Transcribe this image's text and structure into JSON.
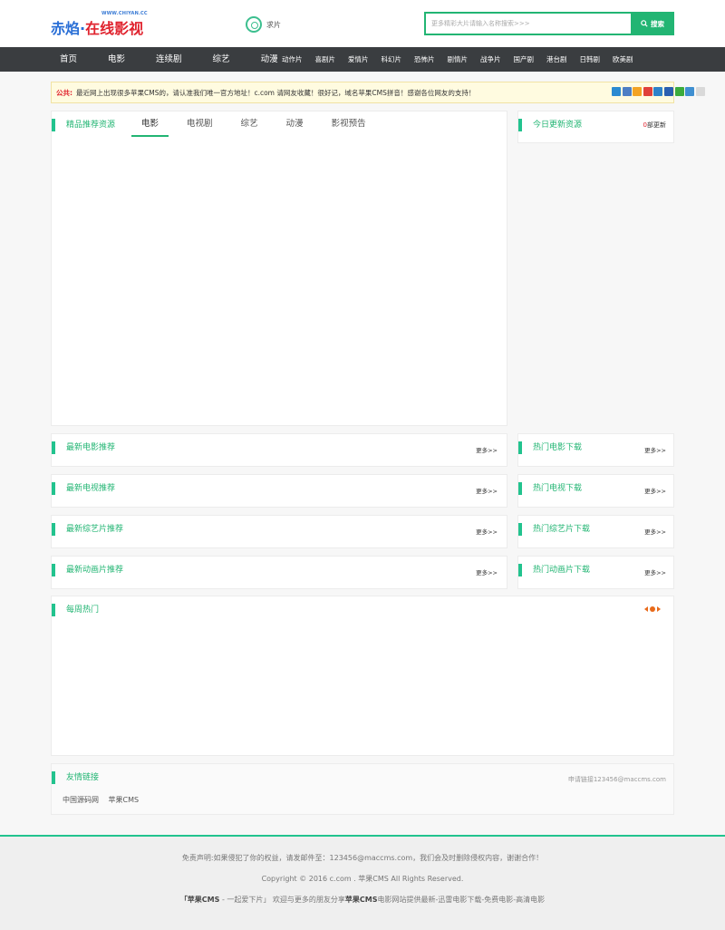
{
  "header": {
    "logo": {
      "subtitle": "WWW.CHIYAN.CC",
      "part1": "赤焰",
      "dot": "·",
      "part2": "在线影视"
    },
    "request_label": "求片",
    "search": {
      "placeholder": "更多精彩大片请输入名称搜索>>>",
      "button_label": "搜索"
    }
  },
  "nav": {
    "main": [
      "首页",
      "电影",
      "连续剧",
      "综艺",
      "动漫"
    ],
    "genres": [
      "动作片",
      "喜剧片",
      "爱情片",
      "科幻片",
      "恐怖片",
      "剧情片",
      "战争片",
      "国产剧",
      "港台剧",
      "日韩剧",
      "欧美剧"
    ]
  },
  "notice": {
    "label": "公共:",
    "text": "最近网上出现很多苹果CMS的，请认准我们唯一官方地址！c.com 请网友收藏！很好记，域名苹果CMS拼音！感谢各位网友的支持！",
    "share_icons": [
      "qzone-icon",
      "qq-icon",
      "weixin-icon",
      "weibo-icon",
      "renren-icon",
      "baidu-icon",
      "kaixin-icon",
      "douban-icon",
      "more-share-icon"
    ],
    "share_colors": [
      "#2b8ad1",
      "#4d7ec4",
      "#f3a323",
      "#e0403a",
      "#2d82c9",
      "#2a5fb0",
      "#3cab3c",
      "#3f8fd1",
      "#d9d9d9"
    ]
  },
  "recommend": {
    "title": "精品推荐资源",
    "tabs": [
      "电影",
      "电视剧",
      "综艺",
      "动漫",
      "影视预告"
    ],
    "active_tab": 0
  },
  "today": {
    "title": "今日更新资源",
    "count": "0",
    "count_suffix": "部更新"
  },
  "sections_left": [
    {
      "title": "最新电影推荐",
      "more": "更多>>"
    },
    {
      "title": "最新电视推荐",
      "more": "更多>>"
    },
    {
      "title": "最新综艺片推荐",
      "more": "更多>>"
    },
    {
      "title": "最新动画片推荐",
      "more": "更多>>"
    }
  ],
  "sections_right": [
    {
      "title": "热门电影下载",
      "more": "更多>>"
    },
    {
      "title": "热门电视下载",
      "more": "更多>>"
    },
    {
      "title": "热门综艺片下载",
      "more": "更多>>"
    },
    {
      "title": "热门动画片下载",
      "more": "更多>>"
    }
  ],
  "weekly": {
    "title": "每周热门"
  },
  "friend_links": {
    "title": "友情链接",
    "apply": "申请链接123456@maccms.com",
    "items": [
      "中国源码网",
      "苹果CMS"
    ]
  },
  "footer": {
    "disclaimer": "免责声明:如果侵犯了你的权益，请发邮件至：123456@maccms.com，我们会及时删除侵权内容，谢谢合作！",
    "copyright": "Copyright © 2016 c.com . 苹果CMS All Rights Reserved.",
    "slogan_bold": "「苹果CMS",
    "slogan_mid": " - 一起爱下片」 欢迎与更多的朋友分享",
    "slogan_bold2": "苹果CMS",
    "slogan_end": "电影网站提供最新-迅雷电影下载-免费电影-高清电影"
  }
}
